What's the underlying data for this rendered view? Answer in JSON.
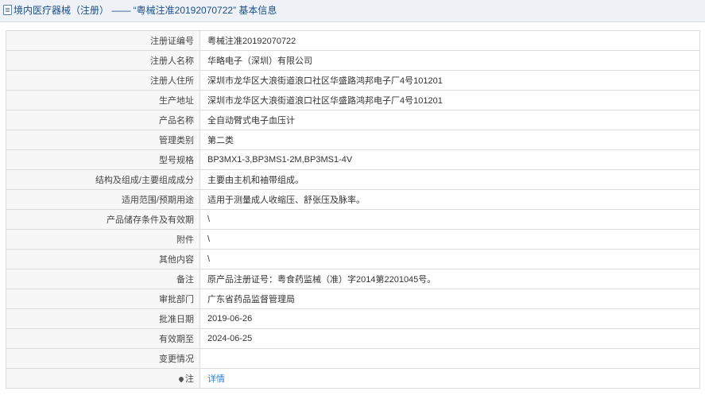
{
  "header": {
    "icon": "document-icon",
    "title": "境内医疗器械（注册） —— “粤械注准20192070722” 基本信息"
  },
  "rows": [
    {
      "label": "注册证编号",
      "value": "粤械注准20192070722"
    },
    {
      "label": "注册人名称",
      "value": "华略电子（深圳）有限公司"
    },
    {
      "label": "注册人住所",
      "value": "深圳市龙华区大浪街道浪口社区华盛路鸿邦电子厂4号101201"
    },
    {
      "label": "生产地址",
      "value": "深圳市龙华区大浪街道浪口社区华盛路鸿邦电子厂4号101201"
    },
    {
      "label": "产品名称",
      "value": "全自动臂式电子血压计"
    },
    {
      "label": "管理类别",
      "value": "第二类"
    },
    {
      "label": "型号规格",
      "value": "BP3MX1-3,BP3MS1-2M,BP3MS1-4V"
    },
    {
      "label": "结构及组成/主要组成成分",
      "value": "主要由主机和袖带组成。"
    },
    {
      "label": "适用范围/预期用途",
      "value": "适用于测量成人收缩压、舒张压及脉率。"
    },
    {
      "label": "产品储存条件及有效期",
      "value": "\\"
    },
    {
      "label": "附件",
      "value": "\\"
    },
    {
      "label": "其他内容",
      "value": "\\"
    },
    {
      "label": "备注",
      "value": "原产品注册证号：粤食药监械（准）字2014第2201045号。"
    },
    {
      "label": "审批部门",
      "value": "广东省药品监督管理局"
    },
    {
      "label": "批准日期",
      "value": "2019-06-26"
    },
    {
      "label": "有效期至",
      "value": "2024-06-25"
    },
    {
      "label": "变更情况",
      "value": ""
    }
  ],
  "note": {
    "icon": "pin-icon",
    "label": "注",
    "link_text": "详情"
  },
  "colors": {
    "link": "#2f7fd0",
    "title": "#1b4e86",
    "label_bg": "#f7f7f7"
  }
}
